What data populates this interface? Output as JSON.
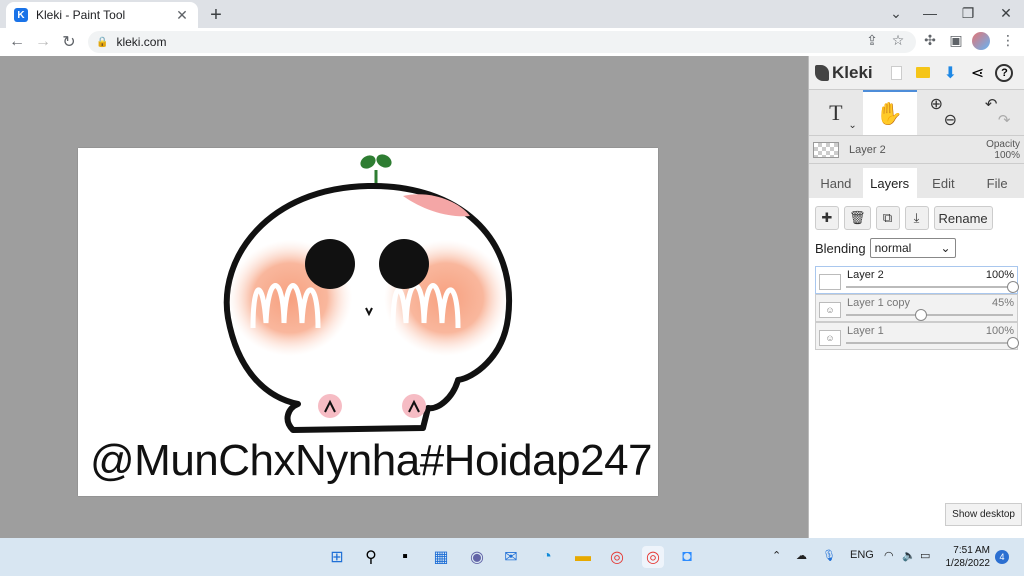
{
  "browser": {
    "tab_title": "Kleki - Paint Tool",
    "tab_favicon_letter": "K",
    "url": "kleki.com"
  },
  "kleki": {
    "logo_text": "Kleki",
    "current_layer_name": "Layer 2",
    "opacity_label": "Opacity",
    "opacity_value": "100%",
    "tabs": [
      {
        "label": "Hand"
      },
      {
        "label": "Layers"
      },
      {
        "label": "Edit"
      },
      {
        "label": "File"
      }
    ],
    "rename_label": "Rename",
    "blending_label": "Blending",
    "blending_value": "normal",
    "layers": [
      {
        "name": "Layer 2",
        "opacity": "100%",
        "opacity_fraction": 1.0
      },
      {
        "name": "Layer 1 copy",
        "opacity": "45%",
        "opacity_fraction": 0.45
      },
      {
        "name": "Layer 1",
        "opacity": "100%",
        "opacity_fraction": 1.0
      }
    ]
  },
  "canvas": {
    "watermark_text": "@MunChxNynha#Hoidap247"
  },
  "desktop": {
    "show_desktop_label": "Show desktop"
  },
  "taskbar": {
    "language": "ENG",
    "time": "7:51 AM",
    "date": "1/28/2022",
    "notification_count": "4"
  },
  "colors": {
    "accent": "#4d8dd9",
    "canvas_bg": "#9e9e9e",
    "taskbar_bg": "#d8e6f2"
  }
}
